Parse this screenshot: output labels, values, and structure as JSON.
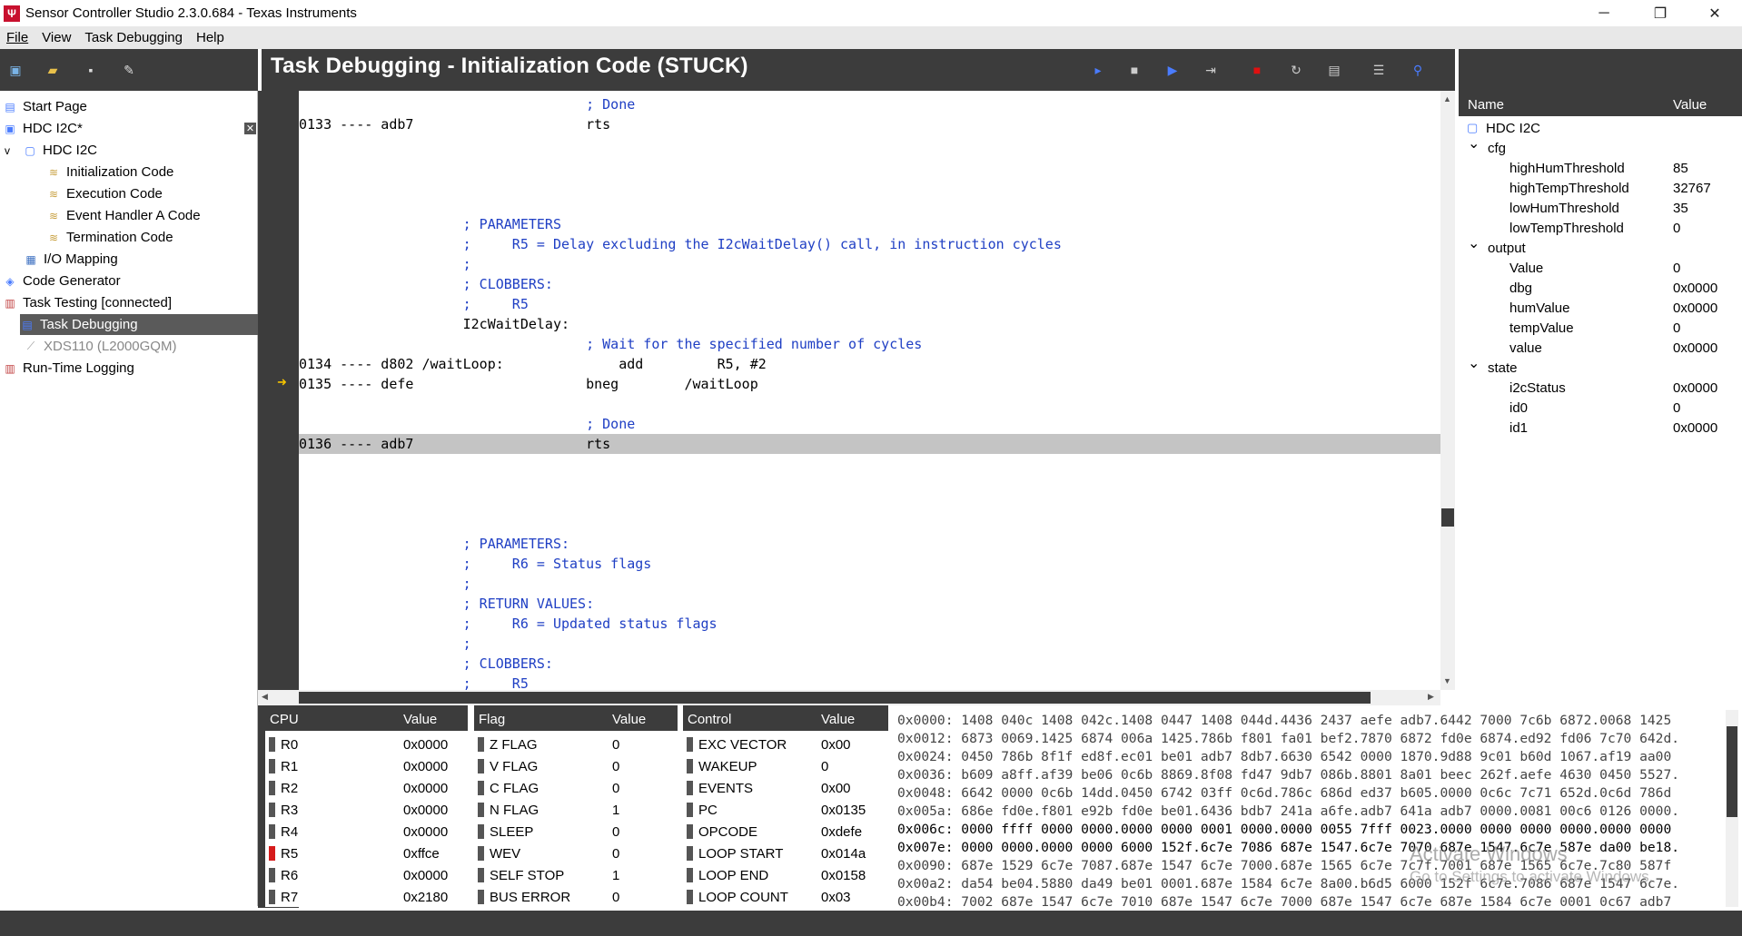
{
  "window": {
    "title": "Sensor Controller Studio 2.3.0.684 - Texas Instruments",
    "minimize": "─",
    "restore": "❐",
    "close": "✕"
  },
  "menu": [
    "File",
    "View",
    "Task Debugging",
    "Help"
  ],
  "page_title": "Task Debugging - Initialization Code (STUCK)",
  "tree": [
    {
      "label": "Start Page",
      "icon": "start-page-icon"
    },
    {
      "label": "HDC I2C*",
      "icon": "project-icon",
      "close": "✕"
    },
    {
      "label": "HDC I2C",
      "icon": "document-icon",
      "toggle": "v"
    },
    {
      "label": "Initialization Code",
      "icon": "code-icon"
    },
    {
      "label": "Execution Code",
      "icon": "code-icon"
    },
    {
      "label": "Event Handler A Code",
      "icon": "code-icon"
    },
    {
      "label": "Termination Code",
      "icon": "code-icon"
    },
    {
      "label": "I/O Mapping",
      "icon": "io-mapping-icon"
    },
    {
      "label": "Code Generator",
      "icon": "generator-icon"
    },
    {
      "label": "Task Testing [connected]",
      "icon": "testing-icon"
    },
    {
      "label": "Task Debugging",
      "icon": "debug-icon"
    },
    {
      "label": "XDS110 (L2000GQM)",
      "icon": "debugger-icon"
    },
    {
      "label": "Run-Time Logging",
      "icon": "logging-icon"
    }
  ],
  "code_lines": [
    {
      "text": "                                   ; Done",
      "cls": "cm"
    },
    {
      "text": "0133 ---- adb7                     rts",
      "cls": ""
    },
    {
      "text": "",
      "cls": ""
    },
    {
      "text": "",
      "cls": ""
    },
    {
      "text": "",
      "cls": ""
    },
    {
      "text": "",
      "cls": ""
    },
    {
      "text": "                    ; PARAMETERS",
      "cls": "cm"
    },
    {
      "text": "                    ;     R5 = Delay excluding the I2cWaitDelay() call, in instruction cycles",
      "cls": "cm"
    },
    {
      "text": "                    ;",
      "cls": "cm"
    },
    {
      "text": "                    ; CLOBBERS:",
      "cls": "cm"
    },
    {
      "text": "                    ;     R5",
      "cls": "cm"
    },
    {
      "text": "                    I2cWaitDelay:",
      "cls": ""
    },
    {
      "text": "                                   ; Wait for the specified number of cycles",
      "cls": "cm"
    },
    {
      "text": "0134 ---- d802 /waitLoop:              add         R5, #2",
      "cls": ""
    },
    {
      "text": "0135 ---- defe                     bneg        /waitLoop",
      "cls": ""
    },
    {
      "text": "",
      "cls": ""
    },
    {
      "text": "                                   ; Done",
      "cls": "cm"
    },
    {
      "text": "0136 ---- adb7                     rts",
      "cls": "hl"
    },
    {
      "text": "",
      "cls": ""
    },
    {
      "text": "",
      "cls": ""
    },
    {
      "text": "",
      "cls": ""
    },
    {
      "text": "",
      "cls": ""
    },
    {
      "text": "                    ; PARAMETERS:",
      "cls": "cm"
    },
    {
      "text": "                    ;     R6 = Status flags",
      "cls": "cm"
    },
    {
      "text": "                    ;",
      "cls": "cm"
    },
    {
      "text": "                    ; RETURN VALUES:",
      "cls": "cm"
    },
    {
      "text": "                    ;     R6 = Updated status flags",
      "cls": "cm"
    },
    {
      "text": "                    ;",
      "cls": "cm"
    },
    {
      "text": "                    ; CLOBBERS:",
      "cls": "cm"
    },
    {
      "text": "                    ;     R5",
      "cls": "cm"
    }
  ],
  "var_panel": {
    "headers": {
      "name": "Name",
      "value": "Value"
    },
    "rows": [
      {
        "indent": 0,
        "label": "HDC I2C",
        "value": "",
        "kind": "root"
      },
      {
        "indent": 1,
        "label": "cfg",
        "value": "",
        "kind": "group"
      },
      {
        "indent": 2,
        "label": "highHumThreshold",
        "value": "85",
        "kind": "leaf"
      },
      {
        "indent": 2,
        "label": "highTempThreshold",
        "value": "32767",
        "kind": "leaf"
      },
      {
        "indent": 2,
        "label": "lowHumThreshold",
        "value": "35",
        "kind": "leaf"
      },
      {
        "indent": 2,
        "label": "lowTempThreshold",
        "value": "0",
        "kind": "leaf"
      },
      {
        "indent": 1,
        "label": "output",
        "value": "",
        "kind": "group"
      },
      {
        "indent": 2,
        "label": "Value",
        "value": "0",
        "kind": "leaf"
      },
      {
        "indent": 2,
        "label": "dbg",
        "value": "0x0000",
        "kind": "leaf"
      },
      {
        "indent": 2,
        "label": "humValue",
        "value": "0x0000",
        "kind": "leaf"
      },
      {
        "indent": 2,
        "label": "tempValue",
        "value": "0",
        "kind": "leaf"
      },
      {
        "indent": 2,
        "label": "value",
        "value": "0x0000",
        "kind": "leaf"
      },
      {
        "indent": 1,
        "label": "state",
        "value": "",
        "kind": "group"
      },
      {
        "indent": 2,
        "label": "i2cStatus",
        "value": "0x0000",
        "kind": "leaf"
      },
      {
        "indent": 2,
        "label": "id0",
        "value": "0",
        "kind": "leaf"
      },
      {
        "indent": 2,
        "label": "id1",
        "value": "0x0000",
        "kind": "leaf"
      }
    ]
  },
  "cpu": {
    "header": "CPU",
    "value_header": "Value",
    "rows": [
      {
        "name": "R0",
        "value": "0x0000",
        "changed": false
      },
      {
        "name": "R1",
        "value": "0x0000",
        "changed": false
      },
      {
        "name": "R2",
        "value": "0x0000",
        "changed": false
      },
      {
        "name": "R3",
        "value": "0x0000",
        "changed": false
      },
      {
        "name": "R4",
        "value": "0x0000",
        "changed": false
      },
      {
        "name": "R5",
        "value": "0xffce",
        "changed": true
      },
      {
        "name": "R6",
        "value": "0x0000",
        "changed": false
      },
      {
        "name": "R7",
        "value": "0x2180",
        "changed": false
      }
    ]
  },
  "flags": {
    "header": "Flag",
    "value_header": "Value",
    "rows": [
      {
        "name": "Z FLAG",
        "value": "0"
      },
      {
        "name": "V FLAG",
        "value": "0"
      },
      {
        "name": "C FLAG",
        "value": "0"
      },
      {
        "name": "N FLAG",
        "value": "1"
      },
      {
        "name": "SLEEP",
        "value": "0"
      },
      {
        "name": "WEV",
        "value": "0"
      },
      {
        "name": "SELF STOP",
        "value": "1"
      },
      {
        "name": "BUS ERROR",
        "value": "0"
      }
    ]
  },
  "control": {
    "header": "Control",
    "value_header": "Value",
    "rows": [
      {
        "name": "EXC VECTOR",
        "value": "0x00"
      },
      {
        "name": "WAKEUP",
        "value": "0"
      },
      {
        "name": "EVENTS",
        "value": "0x00"
      },
      {
        "name": "PC",
        "value": "0x0135"
      },
      {
        "name": "OPCODE",
        "value": "0xdefe"
      },
      {
        "name": "LOOP START",
        "value": "0x014a"
      },
      {
        "name": "LOOP END",
        "value": "0x0158"
      },
      {
        "name": "LOOP COUNT",
        "value": "0x03"
      }
    ]
  },
  "hex_lines": [
    "0x0000: 1408 040c 1408 042c.1408 0447 1408 044d.4436 2437 aefe adb7.6442 7000 7c6b 6872.0068 1425",
    "0x0012: 6873 0069.1425 6874 006a 1425.786b f801 fa01 bef2.7870 6872 fd0e 6874.ed92 fd06 7c70 642d.",
    "0x0024: 0450 786b 8f1f ed8f.ec01 be01 adb7 8db7.6630 6542 0000 1870.9d88 9c01 b60d 1067.af19 aa00",
    "0x0036: b609 a8ff.af39 be06 0c6b 8869.8f08 fd47 9db7 086b.8801 8a01 beec 262f.aefe 4630 0450 5527.",
    "0x0048: 6642 0000 0c6b 14dd.0450 6742 03ff 0c6d.786c 686d ed37 b605.0000 0c6c 7c71 652d.0c6d 786d",
    "0x005a: 686e fd0e.f801 e92b fd0e be01.6436 bdb7 241a a6fe.adb7 641a adb7 0000.0081 00c6 0126 0000.",
    "0x006c: 0000 ffff 0000 0000.0000 0000 0001 0000.0000 0055 7fff 0023.0000 0000 0000 0000.0000 0000",
    "0x007e: 0000 0000.0000 0000 6000 152f.6c7e 7086 687e 1547.6c7e 7070 687e 1547.6c7e 587e da00 be18.",
    "0x0090: 687e 1529 6c7e 7087.687e 1547 6c7e 7000.687e 1565 6c7e 7c7f.7001 687e 1565 6c7e.7c80 587f",
    "0x00a2: da54 be04.5880 da49 be01 0001.687e 1584 6c7e 8a00.b6d5 6000 152f 6c7e.7086 687e 1547 6c7e.",
    "0x00b4: 7002 687e 1547 6c7e 7010 687e 1547 6c7e 7000 687e 1547 6c7e 687e 1584 6c7e 0001 0c67 adb7"
  ],
  "watermark": {
    "line1": "Activate Windows",
    "line2": "Go to Settings to activate Windows."
  },
  "toolbar_left": [
    "new-project-icon",
    "open-icon",
    "save-icon",
    "clean-icon"
  ],
  "toolbar_right": [
    "run-icon",
    "stop-icon",
    "step-icon",
    "step-over-icon",
    "breakpoint-icon",
    "reset-icon",
    "memory-icon",
    "list-icon",
    "connect-icon"
  ],
  "colors": {
    "accent_red": "#c8102e",
    "changed_reg": "#d61b1b",
    "comment_blue": "#1f3fc4",
    "dark_panel": "#3c3c3c"
  }
}
